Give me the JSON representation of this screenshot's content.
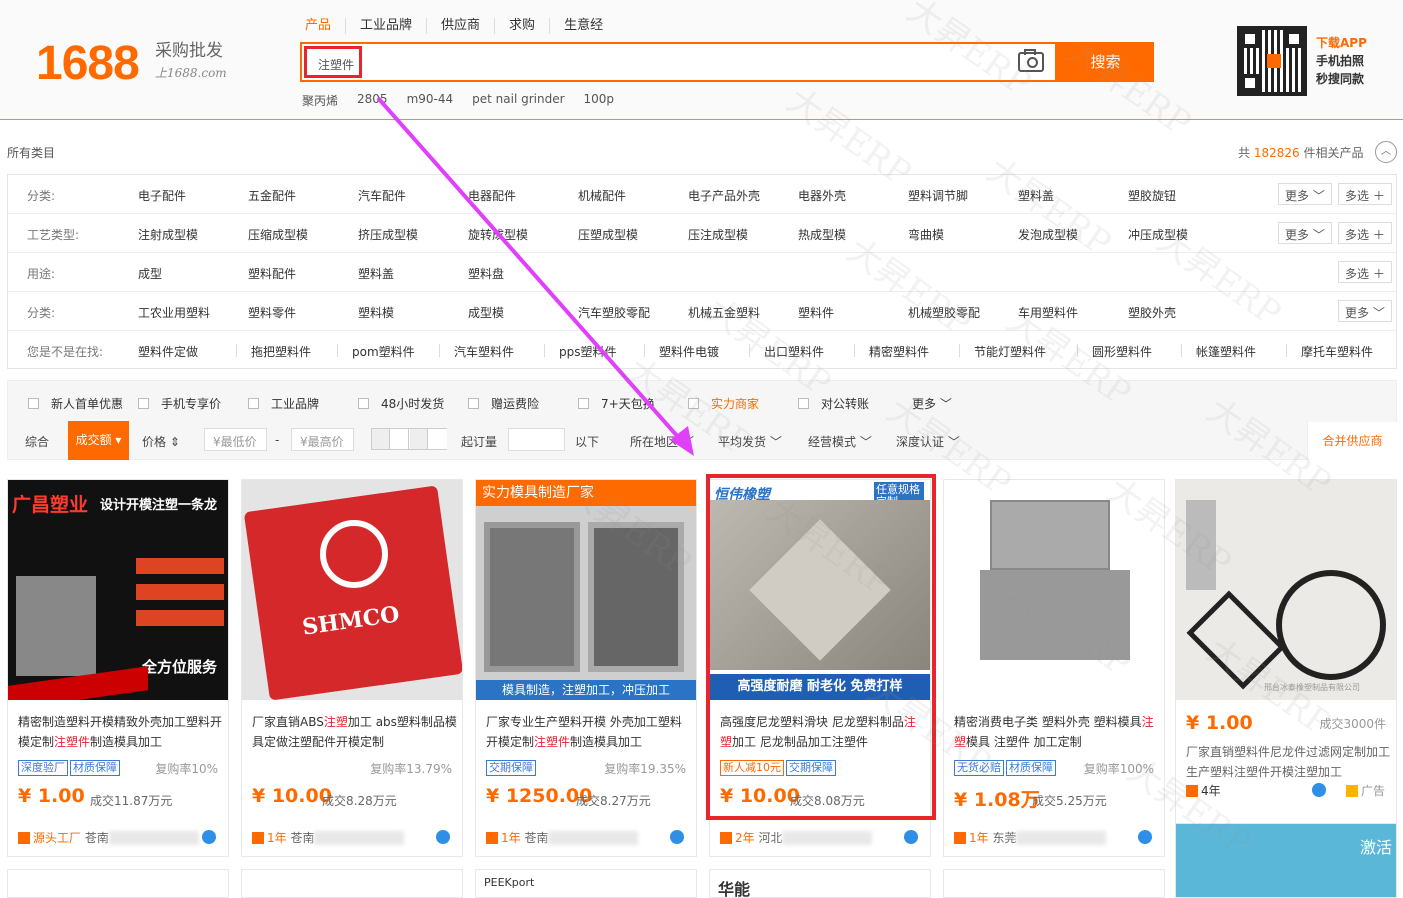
{
  "header": {
    "logo": "1688",
    "slogan": "采购批发",
    "slogan_sub": "上1688.com",
    "search_tabs": [
      "产品",
      "工业品牌",
      "供应商",
      "求购",
      "生意经"
    ],
    "search_value": "注塑件",
    "search_button": "搜索",
    "hot_words": [
      "聚丙烯",
      "2805",
      "m90-44",
      "pet nail grinder",
      "100p"
    ],
    "app_line1": "下载APP",
    "app_line2": "手机拍照",
    "app_line3": "秒搜同款"
  },
  "crumb": {
    "all_categories": "所有类目",
    "total_prefix": "共",
    "total_count": "182826",
    "total_suffix": "件相关产品"
  },
  "filters": {
    "rows": [
      {
        "label": "分类:",
        "items": [
          "电子配件",
          "五金配件",
          "汽车配件",
          "电器配件",
          "机械配件",
          "电子产品外壳",
          "电器外壳",
          "塑料调节脚",
          "塑料盖",
          "塑胶旋钮"
        ],
        "more": "更多",
        "multi": "多选"
      },
      {
        "label": "工艺类型:",
        "items": [
          "注射成型模",
          "压缩成型模",
          "挤压成型模",
          "旋转成型模",
          "压塑成型模",
          "压注成型模",
          "热成型模",
          "弯曲模",
          "发泡成型模",
          "冲压成型模"
        ],
        "more": "更多",
        "multi": "多选"
      },
      {
        "label": "用途:",
        "items": [
          "成型",
          "塑料配件",
          "塑料盖",
          "塑料盘"
        ],
        "more": "",
        "multi": "多选"
      },
      {
        "label": "分类:",
        "items": [
          "工农业用塑料",
          "塑料零件",
          "塑料模",
          "成型模",
          "汽车塑胶零配",
          "机械五金塑料",
          "塑料件",
          "机械塑胶零配",
          "车用塑料件",
          "塑胶外壳"
        ],
        "more": "更多",
        "multi": ""
      }
    ],
    "suggest_label": "您是不是在找:",
    "suggest": [
      "塑料件定做",
      "拖把塑料件",
      "pom塑料件",
      "汽车塑料件",
      "pps塑料件",
      "塑料件电镀",
      "出口塑料件",
      "精密塑料件",
      "节能灯塑料件",
      "圆形塑料件",
      "帐篷塑料件",
      "摩托车塑料件"
    ]
  },
  "sortbar": {
    "checks": [
      "新人首单优惠",
      "手机专享价",
      "工业品牌",
      "48小时发货",
      "赠运费险",
      "7+天包换",
      "实力商家",
      "对公转账"
    ],
    "more": "更多",
    "sorts": [
      "综合",
      "成交额",
      "价格"
    ],
    "min_price": "¥最低价",
    "max_price": "¥最高价",
    "dash": "-",
    "moq_label": "起订量",
    "moq_unit": "以下",
    "dropdowns": [
      "所在地区",
      "平均发货",
      "经营模式",
      "深度认证"
    ],
    "merge": "合并供应商"
  },
  "products": [
    {
      "img_text1": "广昌塑业",
      "img_text2": "设计开模注塑一条龙",
      "img_text3": "全方位服务",
      "title_a": "精密制造塑料开模精致外壳加工塑料开模定制",
      "title_em": "注塑件",
      "title_b": "制造模具加工",
      "tag1": "深度验厂",
      "tag2": "材质保障",
      "rep": "复购率10%",
      "price": "¥ 1.00",
      "deal": "成交11.87万元",
      "foot_label": "源头工厂",
      "foot_text": "苍南"
    },
    {
      "img_text1": "SHMCO",
      "img_text2": "",
      "img_text3": "",
      "title_a": "厂家直销ABS",
      "title_em": "注塑",
      "title_b": "加工 abs塑料制品模具定做注塑配件开模定制",
      "tag1": "",
      "tag2": "",
      "rep": "复购率13.79%",
      "price": "¥ 10.00",
      "deal": "成交8.28万元",
      "foot_label": "1年",
      "foot_text": "苍南"
    },
    {
      "img_text1": "实力模具制造厂家",
      "img_text2": "模具制造，注塑加工，冲压加工",
      "img_text3": "",
      "title_a": "厂家专业生产塑料开模 外壳加工塑料开模定制",
      "title_em": "注塑件",
      "title_b": "制造模具加工",
      "tag1": "交期保障",
      "tag2": "",
      "rep": "复购率19.35%",
      "price": "¥ 1250.00",
      "deal": "成交8.27万元",
      "foot_label": "1年",
      "foot_text": "苍南"
    },
    {
      "img_text1": "恒伟橡塑",
      "img_text2": "高强度耐磨 耐老化 免费打样",
      "img_text3": "任意规格定制",
      "title_a": "高强度尼龙塑料滑块 尼龙塑料制品",
      "title_em": "注塑",
      "title_b": "加工 尼龙制品加工注塑件",
      "tag1": "新人减10元",
      "tag2": "交期保障",
      "rep": "",
      "price": "¥ 10.00",
      "deal": "成交8.08万元",
      "foot_label": "2年",
      "foot_text": "河北"
    },
    {
      "img_text1": "",
      "img_text2": "",
      "img_text3": "",
      "title_a": "精密消费电子类 塑料外壳 塑料模具",
      "title_em": "注塑",
      "title_b": "模具 注塑件 加工定制",
      "tag1": "无货必赔",
      "tag2": "材质保障",
      "rep": "复购率100%",
      "price": "¥ 1.08万",
      "deal": "成交5.25万元",
      "foot_label": "1年",
      "foot_text": "东莞"
    },
    {
      "img_text1": "邢台冰泰橡塑制品有限公司",
      "img_text2": "",
      "img_text3": "",
      "title_a": "厂家直销塑料件尼龙件过滤网定制加工生产塑料注塑件开模注塑加工",
      "title_em": "",
      "title_b": "",
      "tag1": "",
      "tag2": "",
      "rep": "成交3000件",
      "price": "¥ 1.00",
      "deal": "",
      "foot_label": "4年",
      "foot_text": "广告"
    }
  ],
  "row2_texts": [
    "",
    "",
    "PEEKport",
    "华能",
    "",
    "激活"
  ],
  "watermark": "大昇ERP",
  "colors": {
    "accent": "#ff6a00",
    "highlight": "#e8242c",
    "arrow": "#e040fb"
  }
}
